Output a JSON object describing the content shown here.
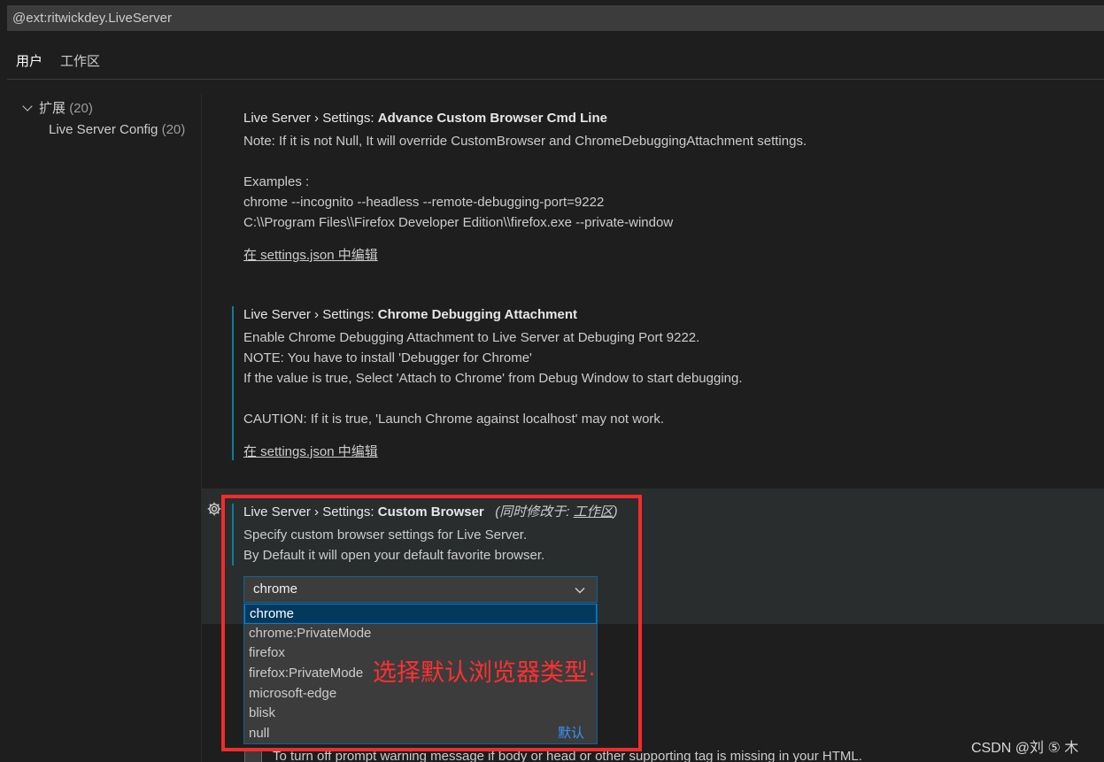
{
  "search": {
    "value": "@ext:ritwickdey.LiveServer"
  },
  "tabs": [
    {
      "label": "用户",
      "active": true
    },
    {
      "label": "工作区",
      "active": false
    }
  ],
  "toc": {
    "group_label": "扩展",
    "group_count": "(20)",
    "child_label": "Live Server Config",
    "child_count": "(20)"
  },
  "settings": [
    {
      "category": "Live Server › Settings: ",
      "name": "Advance Custom Browser Cmd Line",
      "lines": [
        "Note: If it is not Null, It will override CustomBrowser and ChromeDebuggingAttachment settings.",
        "",
        "Examples :",
        "chrome --incognito --headless --remote-debugging-port=9222",
        "C:\\\\Program Files\\\\Firefox Developer Edition\\\\firefox.exe --private-window"
      ],
      "link": "在 settings.json 中编辑"
    },
    {
      "category": "Live Server › Settings: ",
      "name": "Chrome Debugging Attachment",
      "lines": [
        "Enable Chrome Debugging Attachment to Live Server at Debuging Port 9222.",
        "NOTE: You have to install 'Debugger for Chrome'",
        "If the value is true, Select 'Attach to Chrome' from Debug Window to start debugging.",
        "",
        "CAUTION: If it is true, 'Launch Chrome against localhost' may not work."
      ],
      "link": "在 settings.json 中编辑"
    },
    {
      "category": "Live Server › Settings: ",
      "name": "Custom Browser",
      "also_modified_prefix": "(同时修改于: ",
      "also_modified_link": "工作区",
      "also_modified_suffix": ")",
      "lines": [
        "Specify custom browser settings for Live Server.",
        "By Default it will open your default favorite browser."
      ]
    }
  ],
  "custom_browser": {
    "selected": "chrome",
    "options": [
      "chrome",
      "chrome:PrivateMode",
      "firefox",
      "firefox:PrivateMode",
      "microsoft-edge",
      "blisk",
      "null"
    ],
    "default_label": "默认"
  },
  "annotation": "选择默认浏览器类型·",
  "next_setting_desc": "To turn off prompt warning message if body or head or other supporting tag is missing in your HTML.",
  "watermark": "CSDN @刘 ⑤ 木",
  "colors": {
    "background": "#1e1e1e",
    "input": "#3c3c3c",
    "focus_border": "#0e639c",
    "selected_option": "#04395e",
    "annotation_red": "#f22b2b",
    "default_label": "#3794ff"
  }
}
